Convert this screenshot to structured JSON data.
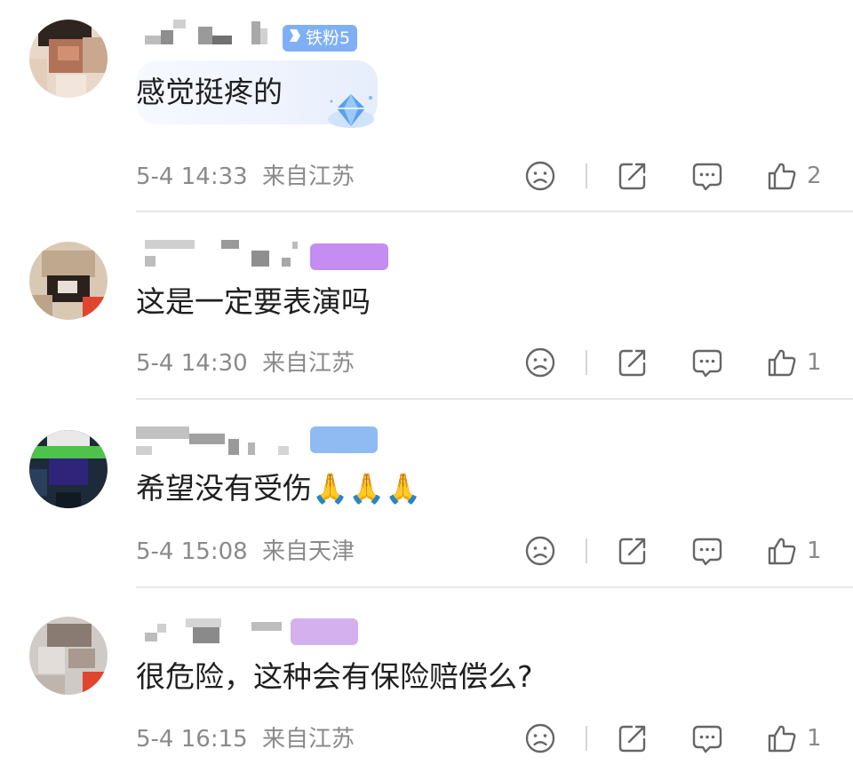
{
  "comments": [
    {
      "badge_text": "铁粉5",
      "text": "感觉挺疼的",
      "time": "5-4 14:33",
      "location": "来自江苏",
      "likes": "2"
    },
    {
      "badge_text": "",
      "text": "这是一定要表演吗",
      "time": "5-4 14:30",
      "location": "来自江苏",
      "likes": "1"
    },
    {
      "badge_text": "",
      "text": "希望没有受伤🙏🙏🙏",
      "time": "5-4 15:08",
      "location": "来自天津",
      "likes": "1"
    },
    {
      "badge_text": "",
      "text": "很危险，这种会有保险赔偿么?",
      "time": "5-4 16:15",
      "location": "来自江苏",
      "likes": "1"
    }
  ],
  "icons": {
    "dislike": "frown-face-icon",
    "share": "share-icon",
    "reply": "comment-bubble-icon",
    "like": "thumbs-up-icon",
    "sticker": "diamond-sticker"
  },
  "colors": {
    "meta_text": "#8a8a8a",
    "comment_text": "#1f1f1f",
    "badge_blue": "#7fb0f5",
    "badge_purple": "#c58cf2"
  }
}
